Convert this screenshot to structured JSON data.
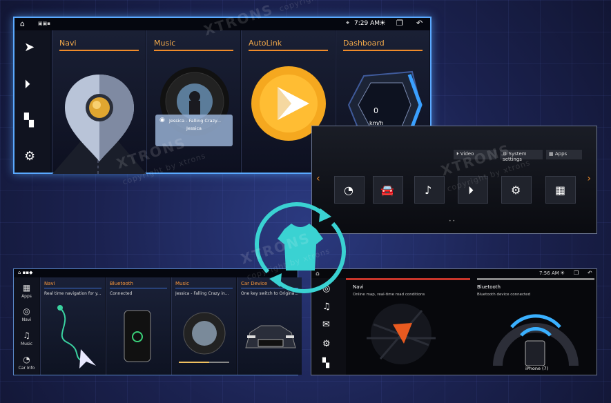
{
  "watermark": {
    "brand": "XTRONS",
    "copyright": "copyright by xtrons"
  },
  "screen1": {
    "status": {
      "time": "7:29 AM"
    },
    "cards": [
      {
        "title": "Navi"
      },
      {
        "title": "Music",
        "song": "Jessica - Falling Crazy...",
        "artist": "Jessica"
      },
      {
        "title": "AutoLink"
      },
      {
        "title": "Dashboard",
        "unit": "km/h",
        "speed": "0"
      }
    ]
  },
  "screen2": {
    "tabs": [
      "Video",
      "System settings",
      "Apps"
    ]
  },
  "screen3": {
    "sidebar": [
      "Apps",
      "Navi",
      "Music",
      "Car Info"
    ],
    "cards": [
      {
        "title": "Navi",
        "subtitle": "Real time navigation for y..."
      },
      {
        "title": "Bluetooth",
        "subtitle": "Connected"
      },
      {
        "title": "Music",
        "subtitle": "Jessica - Falling Crazy in..."
      },
      {
        "title": "Car Device",
        "subtitle": "One key switch to Origina..."
      }
    ]
  },
  "screen4": {
    "status": {
      "time": "7:56 AM"
    },
    "navi": {
      "title": "Navi",
      "subtitle": "Online map, real-time road conditions"
    },
    "bluetooth": {
      "title": "Bluetooth",
      "subtitle": "Bluetooth device connected",
      "device": "iPhone (7)"
    }
  },
  "colors": {
    "accent_orange": "#f08b2a",
    "accent_blue": "#5aa9ff",
    "sync_teal": "#3ad2d2"
  }
}
